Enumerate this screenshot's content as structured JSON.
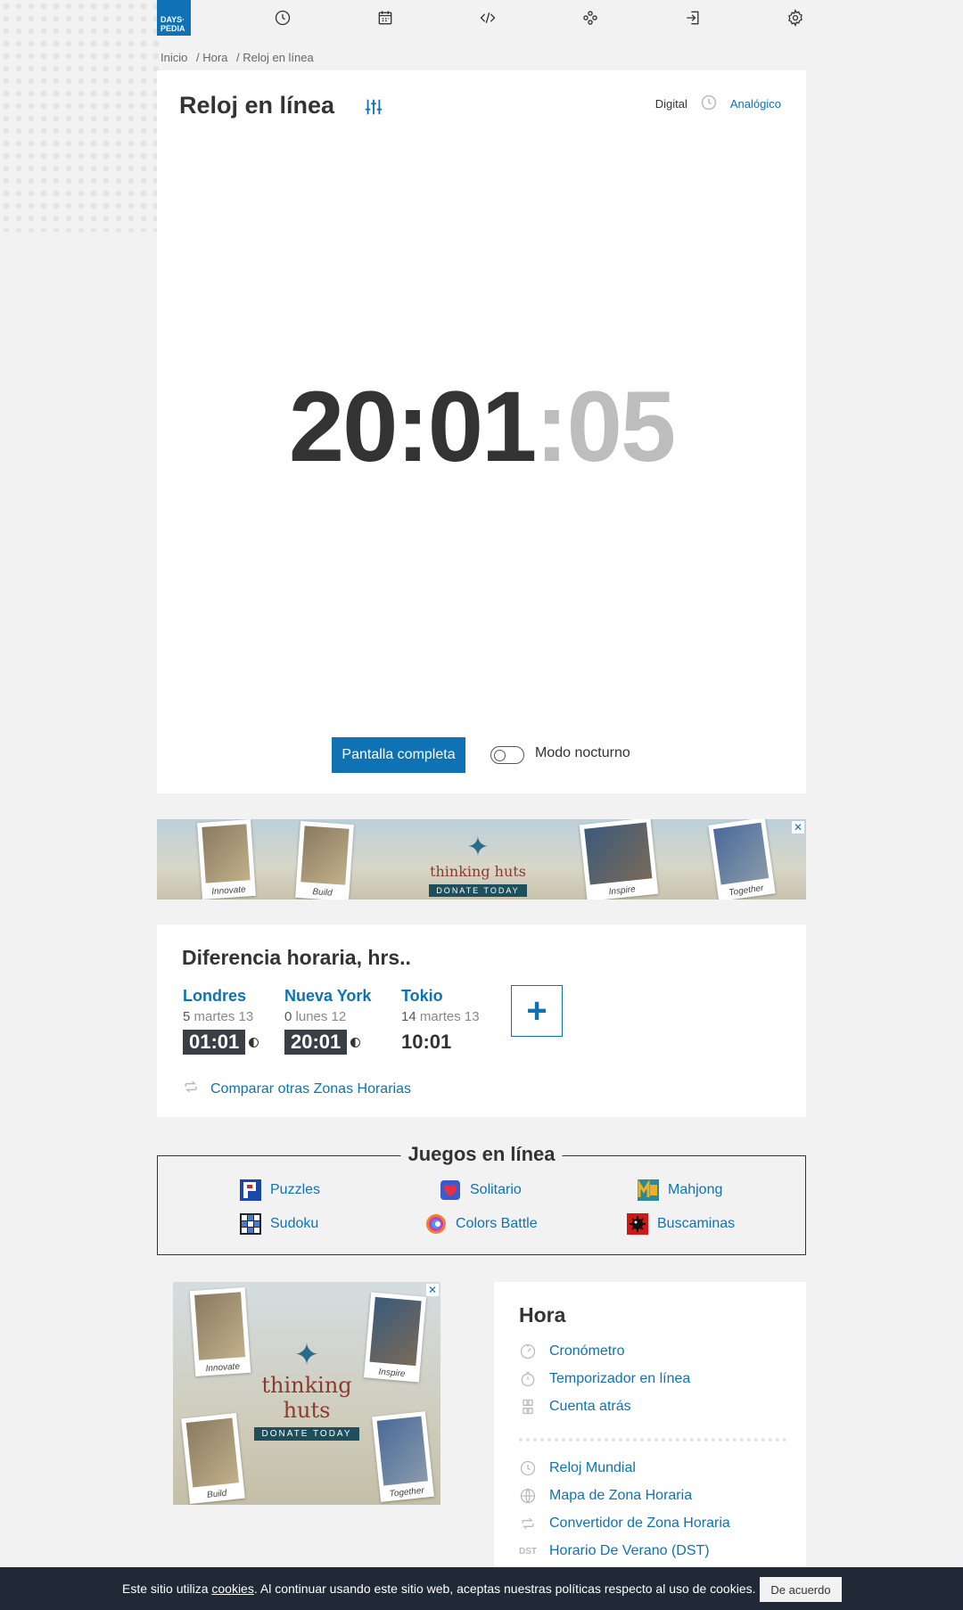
{
  "brand": {
    "logo_line1": "DAYS·",
    "logo_line2": "PEDIA"
  },
  "breadcrumb": [
    "Inicio",
    "/ Hora",
    "/ Reloj en línea"
  ],
  "clock": {
    "title": "Reloj en línea",
    "mode_digital": "Digital",
    "mode_analog": "Analógico",
    "time_hm": "20:01",
    "time_sec": ":05",
    "fullscreen_label": "Pantalla completa",
    "night_mode_label": "Modo nocturno"
  },
  "ad": {
    "brand": "thinking huts",
    "cta": "DONATE TODAY",
    "captions": [
      "Innovate",
      "Build",
      "Inspire",
      "Together"
    ]
  },
  "timezones": {
    "title": "Diferencia horaria, hrs..",
    "cities": [
      {
        "name": "Londres",
        "offset": "5",
        "day": "martes 13",
        "time": "01:01"
      },
      {
        "name": "Nueva York",
        "offset": "0",
        "day": "lunes 12",
        "time": "20:01"
      },
      {
        "name": "Tokio",
        "offset": "14",
        "day": "martes 13",
        "time": "10:01"
      }
    ],
    "add_label": "+",
    "compare_label": "Comparar otras Zonas Horarias"
  },
  "games": {
    "title": "Juegos en línea",
    "items": [
      "Puzzles",
      "Solitario",
      "Mahjong",
      "Sudoku",
      "Colors Battle",
      "Buscaminas"
    ]
  },
  "hora": {
    "title": "Hora",
    "items": [
      "Cronómetro",
      "Temporizador en línea",
      "Cuenta atrás",
      "Reloj Mundial",
      "Mapa de Zona Horaria",
      "Convertidor de Zona Horaria",
      "Horario De Verano (DST)"
    ],
    "dst_icon_text": "DST"
  },
  "cookie": {
    "text_before": "Este sitio utiliza ",
    "link": "cookies",
    "text_after": ". Al continuar usando este sitio web, aceptas nuestras políticas respecto al uso de cookies.",
    "accept_label": "De acuerdo"
  },
  "colors": {
    "accent": "#0e72b5",
    "dark": "#333333",
    "cookie_bar": "#1f2a36"
  }
}
